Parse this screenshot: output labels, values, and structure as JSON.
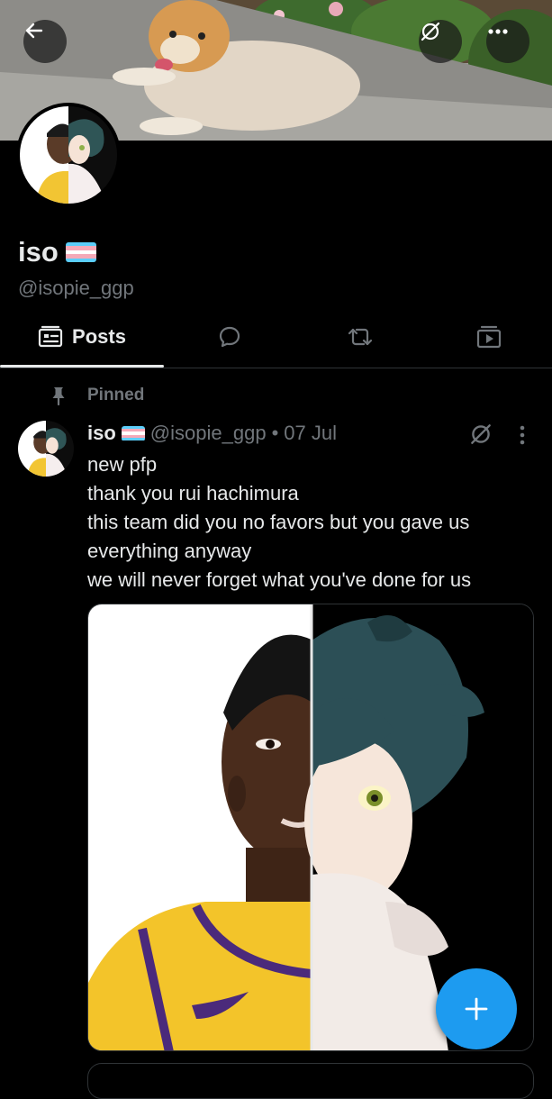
{
  "profile": {
    "name": "iso",
    "handle": "@isopie_ggp",
    "flag_colors": [
      "#5bcefa",
      "#f5a9b8",
      "#ffffff",
      "#f5a9b8",
      "#5bcefa"
    ]
  },
  "header": {
    "back_icon": "arrow-left-icon",
    "grok_icon": "slashed-circle-icon",
    "more_icon": "more-horizontal-icon"
  },
  "tabs": [
    {
      "label": "Posts",
      "icon": "posts-icon",
      "active": true
    },
    {
      "label": "",
      "icon": "reply-bubble-icon",
      "active": false
    },
    {
      "label": "",
      "icon": "repost-icon",
      "active": false
    },
    {
      "label": "",
      "icon": "media-video-icon",
      "active": false
    }
  ],
  "pinned_post": {
    "pinned_label": "Pinned",
    "author_name": "iso",
    "author_handle": "@isopie_ggp",
    "separator": "•",
    "date": "07 Jul",
    "lines": [
      "new pfp",
      "thank you rui hachimura",
      "this team did you no favors but you gave us",
      "everything anyway",
      "we will never forget what you've done for us"
    ]
  },
  "fab": {
    "icon": "plus-icon"
  },
  "colors": {
    "accent": "#1d9bf0",
    "muted": "#71767b",
    "text": "#e7e9ea",
    "border": "#2f3336"
  }
}
